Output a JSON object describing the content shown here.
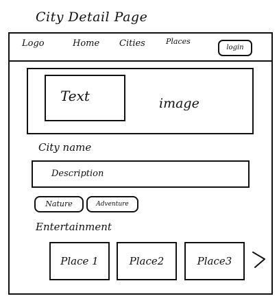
{
  "page_title": "City Detail Page",
  "navbar": {
    "logo": "Logo",
    "links": [
      "Home",
      "Cities",
      "Places"
    ],
    "login_label": "login"
  },
  "hero": {
    "text_label": "Text",
    "image_label": "image"
  },
  "city": {
    "name_label": "City name",
    "description_label": "Description"
  },
  "tags": [
    "Nature",
    "Adventure"
  ],
  "entertainment": {
    "heading": "Entertainment",
    "places": [
      "Place 1",
      "Place2",
      "Place3"
    ],
    "next_icon": "chevron-right-icon"
  }
}
